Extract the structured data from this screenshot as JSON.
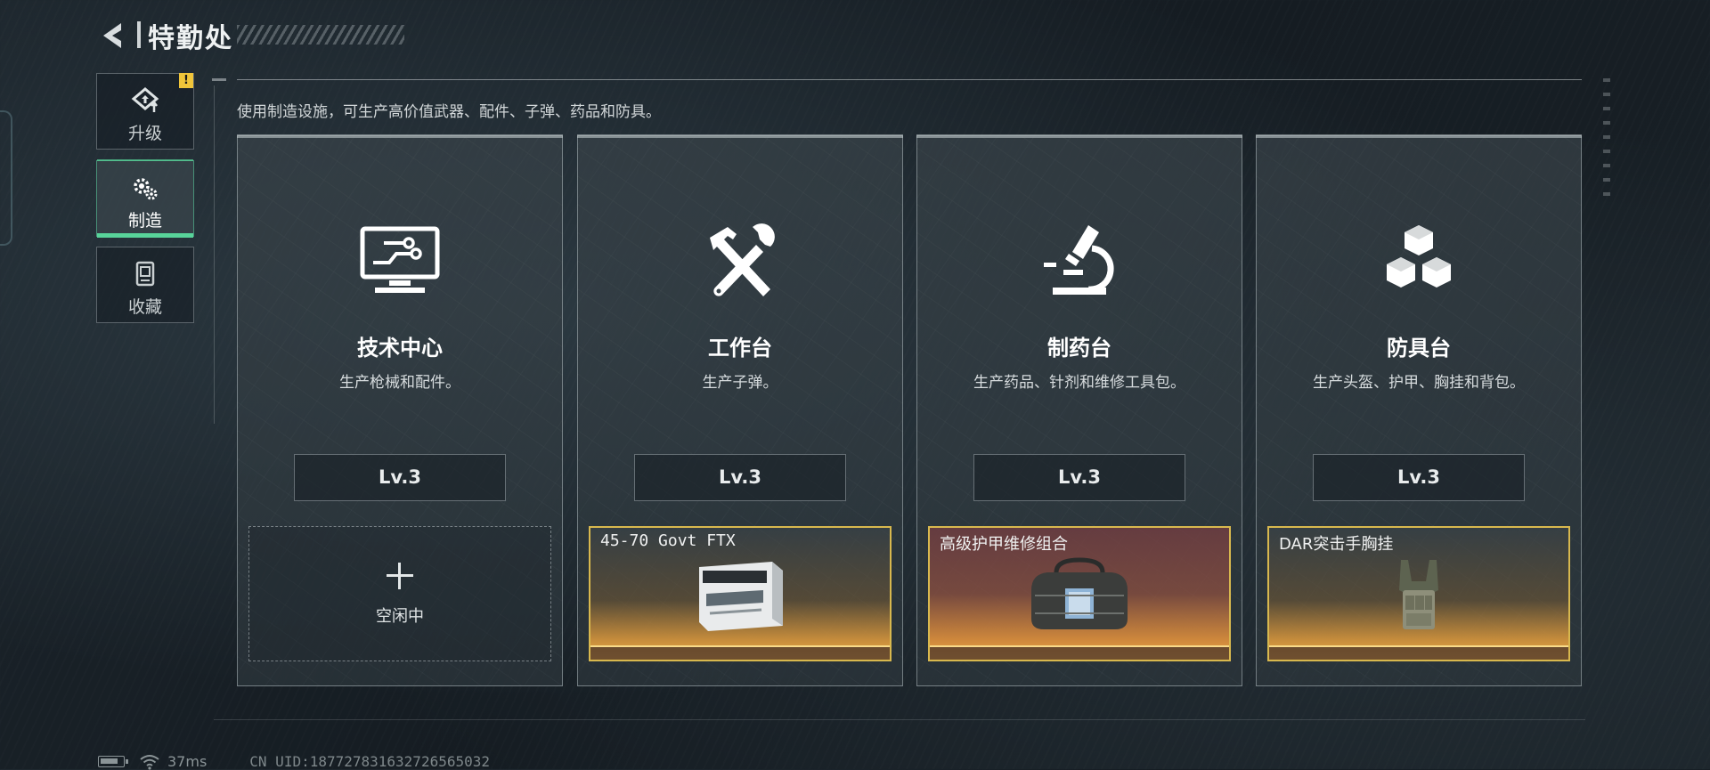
{
  "header": {
    "title": "特勤处"
  },
  "sidebar": {
    "items": [
      {
        "label": "升级",
        "icon": "upgrade-icon",
        "badge": "!"
      },
      {
        "label": "制造",
        "icon": "crafting-gears-icon",
        "active": true
      },
      {
        "label": "收藏",
        "icon": "collection-icon"
      }
    ]
  },
  "description": "使用制造设施，可生产高价值武器、配件、子弹、药品和防具。",
  "stations": [
    {
      "name": "技术中心",
      "desc": "生产枪械和配件。",
      "level": "Lv.3",
      "icon": "computer-circuit-icon",
      "slot": {
        "state": "idle",
        "label": "空闲中"
      }
    },
    {
      "name": "工作台",
      "desc": "生产子弹。",
      "level": "Lv.3",
      "icon": "hammer-wrench-icon",
      "slot": {
        "state": "producing",
        "item": "45-70 Govt FTX",
        "art": "ammo-box-icon"
      }
    },
    {
      "name": "制药台",
      "desc": "生产药品、针剂和维修工具包。",
      "level": "Lv.3",
      "icon": "microscope-icon",
      "slot": {
        "state": "producing",
        "item": "高级护甲维修组合",
        "art": "repair-bag-icon"
      }
    },
    {
      "name": "防具台",
      "desc": "生产头盔、护甲、胸挂和背包。",
      "level": "Lv.3",
      "icon": "cubes-icon",
      "slot": {
        "state": "producing",
        "item": "DAR突击手胸挂",
        "art": "chest-rig-icon"
      }
    }
  ],
  "status": {
    "ping": "37ms",
    "uid": "CN UID:1877278316327265650​32"
  },
  "colors": {
    "accent_green": "#58d49a",
    "gold": "#d8b84e",
    "badge": "#f0c53a"
  }
}
